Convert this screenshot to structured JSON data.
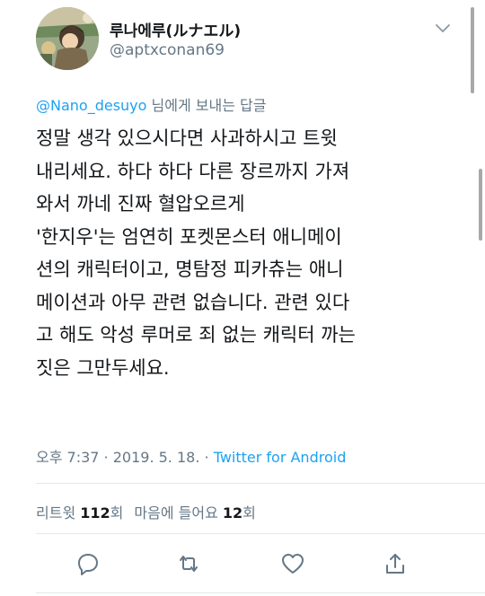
{
  "user": {
    "display_name": "루나에루(ルナエル)",
    "handle": "@aptxconan69"
  },
  "reply": {
    "mention": "@Nano_desuyo",
    "suffix": " 님에게 보내는 답글"
  },
  "tweet": {
    "lines": [
      "정말 생각 있으시다면 사과하시고 트윗",
      "내리세요. 하다 하다 다른 장르까지 가져",
      "와서 까네 진짜 혈압오르게",
      "'한지우'는 엄연히 포켓몬스터 애니메이",
      "션의 캐릭터이고, 명탐정 피카츄는 애니",
      "메이션과 아무 관련 없습니다. 관련 있다",
      "고 해도 악성 루머로 죄 없는 캐릭터 까는",
      "짓은 그만두세요."
    ]
  },
  "meta": {
    "time": "오후 7:37",
    "sep1": " · ",
    "date": "2019. 5. 18.",
    "sep2": " · ",
    "source": "Twitter for Android"
  },
  "stats": {
    "retweet_label": "리트윗 ",
    "retweet_count": "112",
    "retweet_unit": "회",
    "like_label": "마음에 들어요 ",
    "like_count": "12",
    "like_unit": "회"
  },
  "actions": {
    "icons": [
      "reply-icon",
      "retweet-icon",
      "like-icon",
      "share-icon"
    ]
  },
  "colors": {
    "accent": "#1da1f2",
    "secondary_text": "#657786",
    "primary_text": "#14171a",
    "divider": "#e1e8ed"
  }
}
